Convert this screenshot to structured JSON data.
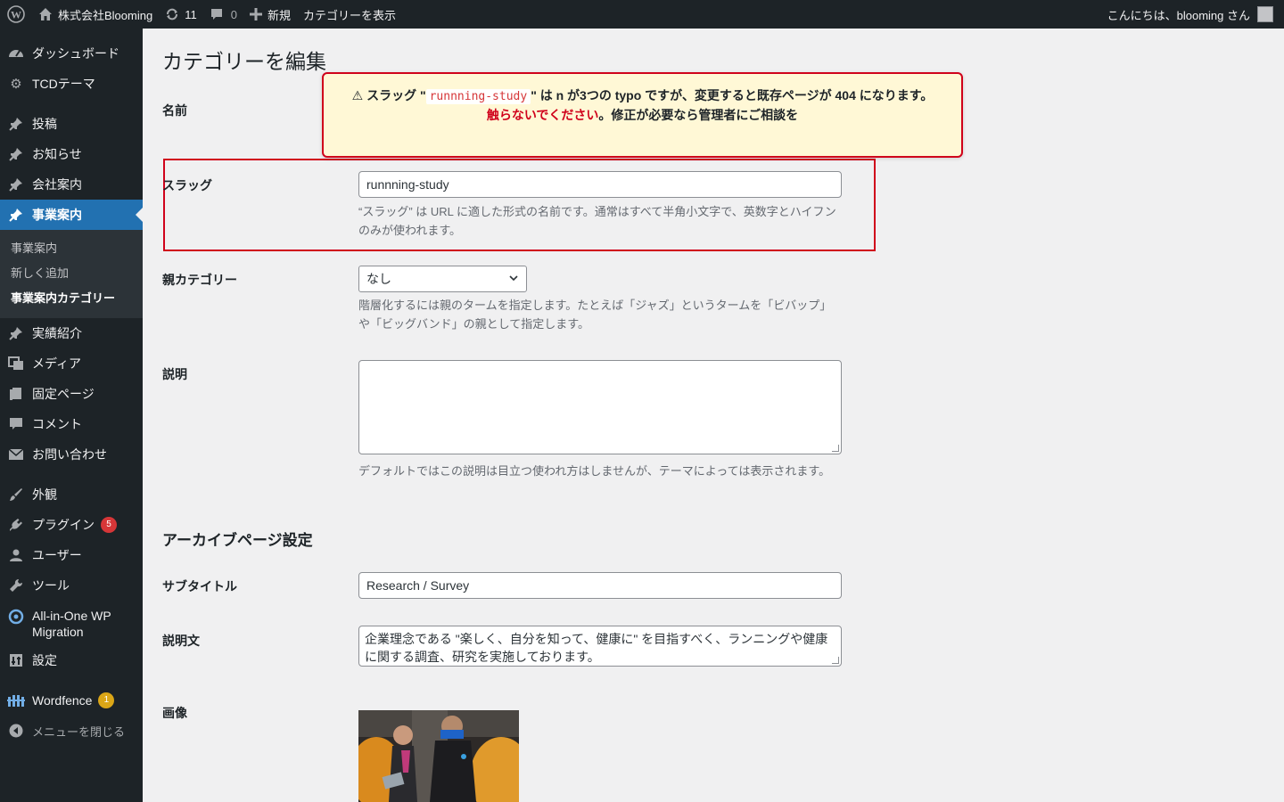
{
  "adminbar": {
    "site_name": "株式会社Blooming",
    "updates_count": "11",
    "comments_count": "0",
    "new_label": "新規",
    "view_category": "カテゴリーを表示",
    "greeting": "こんにちは、blooming さん"
  },
  "sidebar": {
    "items": [
      {
        "label": "ダッシュボード",
        "icon": "dashboard-icon"
      },
      {
        "label": "TCDテーマ",
        "icon": "gear-icon"
      },
      {
        "label": "投稿",
        "icon": "pin-icon"
      },
      {
        "label": "お知らせ",
        "icon": "pin-icon"
      },
      {
        "label": "会社案内",
        "icon": "pin-icon"
      },
      {
        "label": "事業案内",
        "icon": "pin-icon"
      },
      {
        "label": "実績紹介",
        "icon": "pin-icon"
      },
      {
        "label": "メディア",
        "icon": "media-icon"
      },
      {
        "label": "固定ページ",
        "icon": "page-icon"
      },
      {
        "label": "コメント",
        "icon": "comment-icon"
      },
      {
        "label": "お問い合わせ",
        "icon": "mail-icon"
      },
      {
        "label": "外観",
        "icon": "brush-icon"
      },
      {
        "label": "プラグイン",
        "icon": "plugin-icon",
        "badge": "5"
      },
      {
        "label": "ユーザー",
        "icon": "user-icon"
      },
      {
        "label": "ツール",
        "icon": "wrench-icon"
      },
      {
        "label": "All-in-One WP Migration",
        "icon": "migration-icon"
      },
      {
        "label": "設定",
        "icon": "settings-icon"
      },
      {
        "label": "Wordfence",
        "icon": "wordfence-icon",
        "badge": "1"
      },
      {
        "label": "メニューを閉じる",
        "icon": "collapse-icon"
      }
    ],
    "submenu": [
      "事業案内",
      "新しく追加",
      "事業案内カテゴリー"
    ]
  },
  "page": {
    "title": "カテゴリーを編集",
    "name_label": "名前",
    "slug_label": "スラッグ",
    "slug_value": "runnning-study",
    "slug_description": "“スラッグ” は URL に適した形式の名前です。通常はすべて半角小文字で、英数字とハイフンのみが使われます。",
    "parent_label": "親カテゴリー",
    "parent_value": "なし",
    "parent_description": "階層化するには親のタームを指定します。たとえば「ジャズ」というタームを「ビバップ」や「ビッグバンド」の親として指定します。",
    "description_label": "説明",
    "description_value": "",
    "description_help": "デフォルトではこの説明は目立つ使われ方はしませんが、テーマによっては表示されます。",
    "archive_section": "アーカイブページ設定",
    "subtitle_label": "サブタイトル",
    "subtitle_value": "Research / Survey",
    "desc_text_label": "説明文",
    "desc_text_value": "企業理念である \"楽しく、自分を知って、健康に\" を目指すべく、ランニングや健康に関する調査、研究を実施しております。",
    "image_label": "画像"
  },
  "warning": {
    "prefix": "⚠ スラッグ \"",
    "code": "runnning-study",
    "middle": "\" は n が3つの typo ですが、変更すると既存ページが 404 になります。",
    "red_part": "触らないでください",
    "suffix": "。修正が必要なら管理者にご相談を"
  },
  "colors": {
    "admin_dark": "#1d2327",
    "accent": "#2271b1",
    "alert_red": "#d0021b",
    "warning_bg": "#fff8d6"
  }
}
